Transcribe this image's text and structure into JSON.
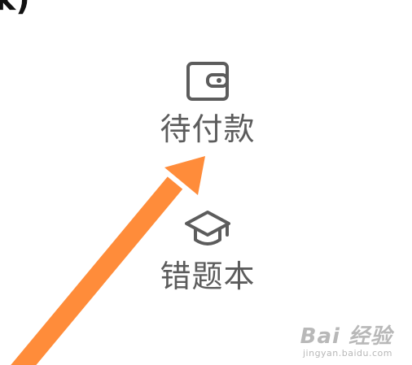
{
  "corner_text": "k)",
  "menu": {
    "pending_payment": {
      "label": "待付款",
      "icon": "wallet-icon"
    },
    "wrong_questions": {
      "label": "错题本",
      "icon": "graduation-cap-icon"
    }
  },
  "watermark": {
    "brand": "Bai 经验",
    "url": "jingyan.baidu.com"
  },
  "colors": {
    "label": "#5c5c5c",
    "icon": "#5c5c5c",
    "arrow": "#ff8c3a",
    "watermark": "#b8b8b8"
  }
}
